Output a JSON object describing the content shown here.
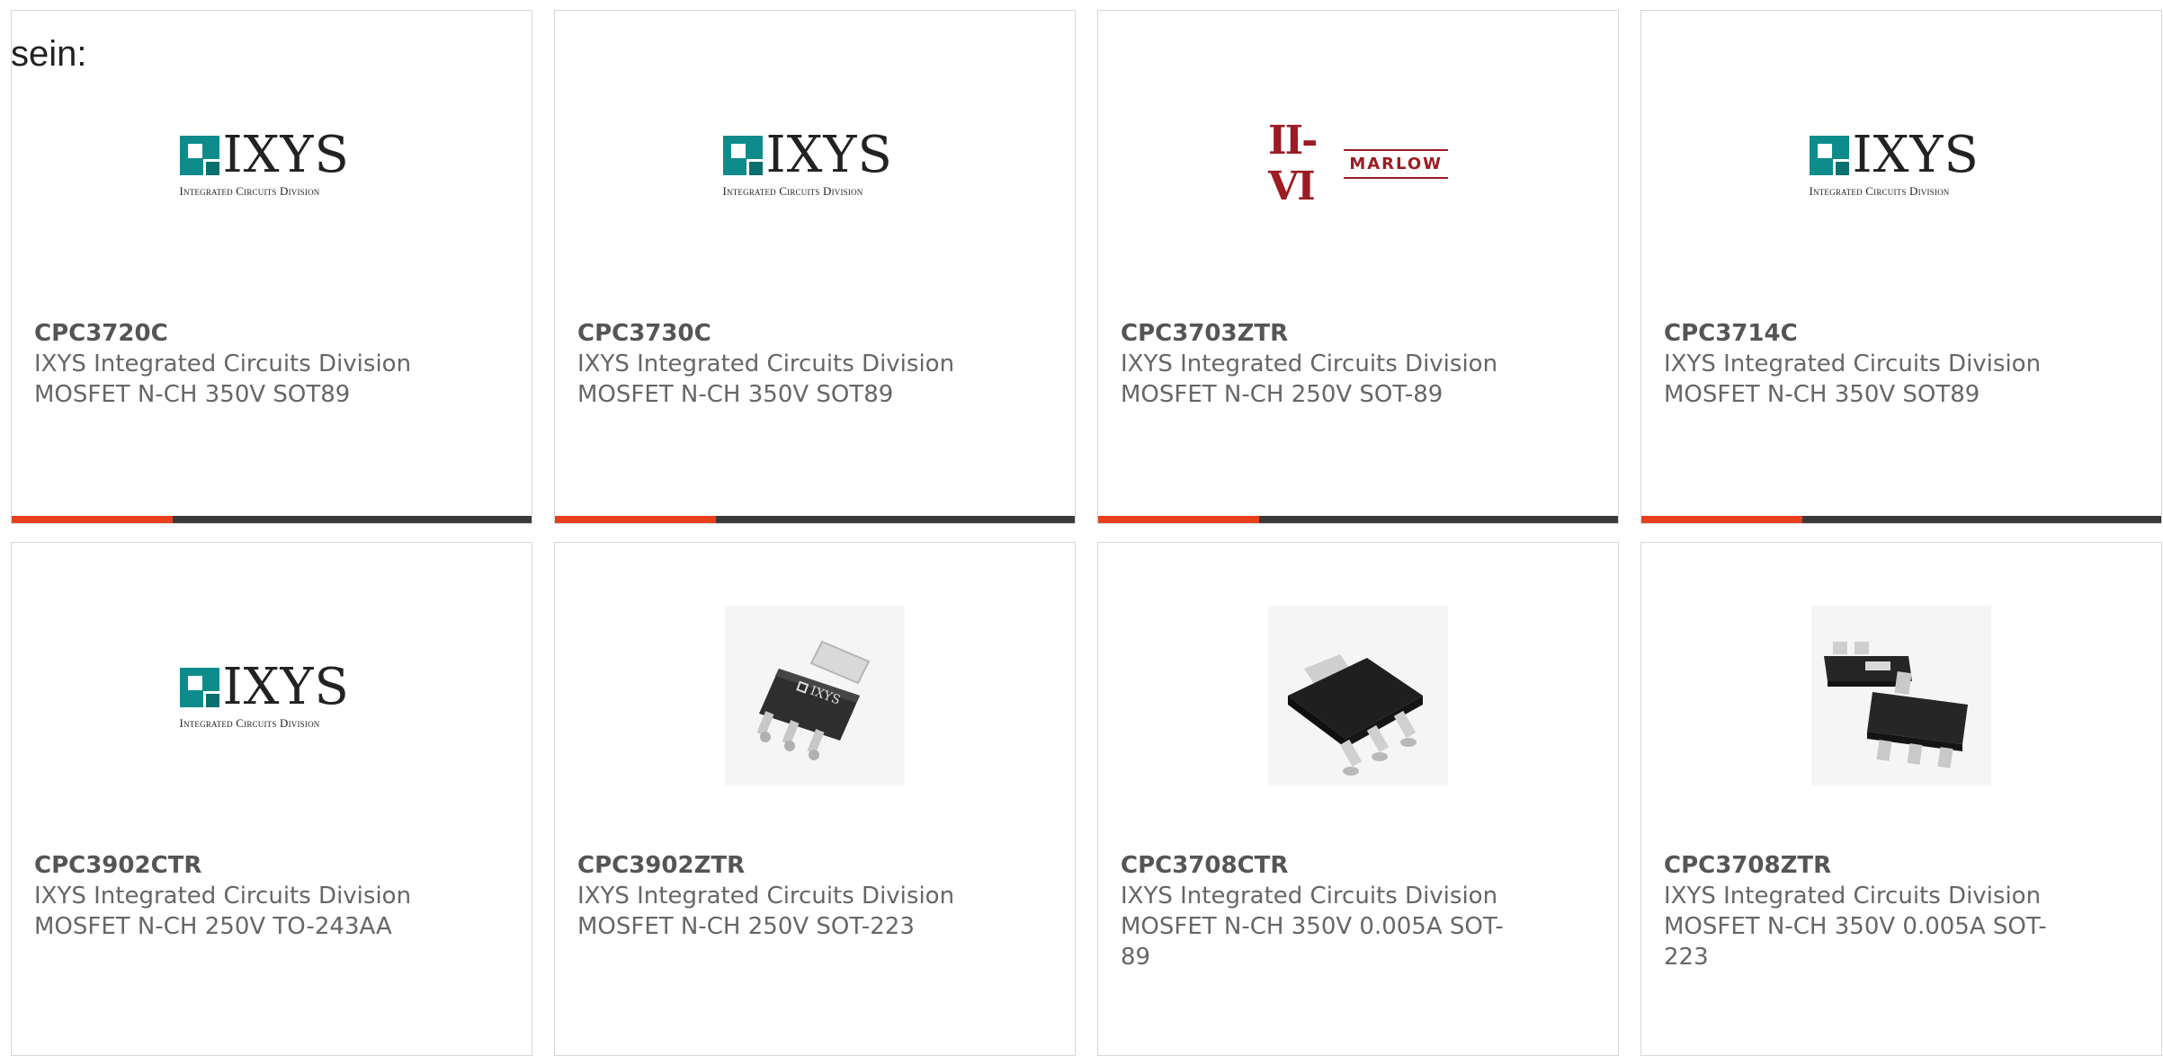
{
  "intro_text": "sein:",
  "products": [
    {
      "part": "CPC3720C",
      "manufacturer": "IXYS Integrated Circuits Division",
      "description": "MOSFET N-CH 350V SOT89",
      "image": "ixys-logo",
      "logo_word": "IXYS",
      "logo_sub": "Integrated Circuits Division"
    },
    {
      "part": "CPC3730C",
      "manufacturer": "IXYS Integrated Circuits Division",
      "description": "MOSFET N-CH 350V SOT89",
      "image": "ixys-logo",
      "logo_word": "IXYS",
      "logo_sub": "Integrated Circuits Division"
    },
    {
      "part": "CPC3703ZTR",
      "manufacturer": "IXYS Integrated Circuits Division",
      "description": "MOSFET N-CH 250V SOT-89",
      "image": "marlow-logo",
      "logo_word": "II-VI",
      "logo_sub": "MARLOW"
    },
    {
      "part": "CPC3714C",
      "manufacturer": "IXYS Integrated Circuits Division",
      "description": "MOSFET N-CH 350V SOT89",
      "image": "ixys-logo",
      "logo_word": "IXYS",
      "logo_sub": "Integrated Circuits Division"
    },
    {
      "part": "CPC3902CTR",
      "manufacturer": "IXYS Integrated Circuits Division",
      "description": "MOSFET N-CH 250V TO-243AA",
      "image": "ixys-logo",
      "logo_word": "IXYS",
      "logo_sub": "Integrated Circuits Division"
    },
    {
      "part": "CPC3902ZTR",
      "manufacturer": "IXYS Integrated Circuits Division",
      "description": "MOSFET N-CH 250V SOT-223",
      "image": "sot223-chip-photo",
      "logo_word": "IXYS",
      "logo_sub": ""
    },
    {
      "part": "CPC3708CTR",
      "manufacturer": "IXYS Integrated Circuits Division",
      "description": "MOSFET N-CH 350V 0.005A SOT-89",
      "image": "sot89-chip-photo",
      "logo_word": "",
      "logo_sub": ""
    },
    {
      "part": "CPC3708ZTR",
      "manufacturer": "IXYS Integrated Circuits Division",
      "description": "MOSFET N-CH 350V 0.005A SOT-223",
      "image": "sot223-pair-photo",
      "logo_word": "",
      "logo_sub": ""
    }
  ],
  "colors": {
    "accent": "#e8401c",
    "bar": "#3a3a3a",
    "ixys_teal": "#0e8c8c",
    "marlow_red": "#9b1c22"
  },
  "card_progress_fraction": 0.31
}
